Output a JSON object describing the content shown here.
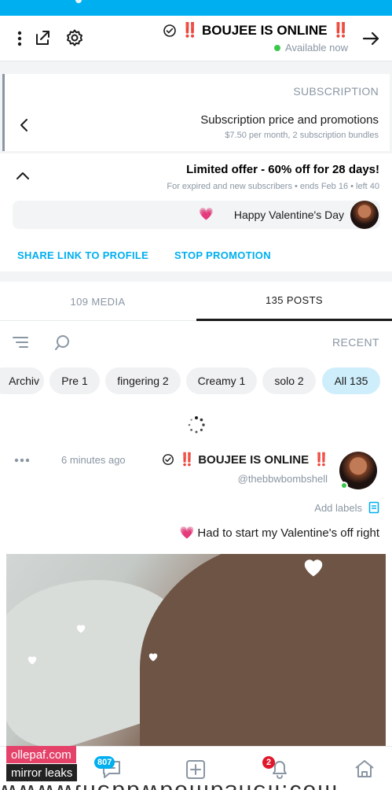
{
  "header": {
    "name": "BOUJEE IS ONLINE",
    "red_marks": "‼️",
    "status": "Available now"
  },
  "subscription": {
    "heading": "SUBSCRIPTION",
    "title": "Subscription price and promotions",
    "detail": "$7.50 per month, 2 subscription bundles"
  },
  "offer": {
    "title": "Limited offer - 60% off for 28 days!",
    "detail": "For expired and new subscribers • ends Feb 16 • left 40",
    "message": "Happy Valentine's Day",
    "message_emoji": "💗",
    "share_link": "SHARE LINK TO PROFILE",
    "stop_promotion": "STOP PROMOTION"
  },
  "tabs": [
    {
      "label": "135 POSTS"
    },
    {
      "label": "109 MEDIA"
    }
  ],
  "filter": {
    "sort_label": "RECENT"
  },
  "chips": [
    {
      "label": "All 135"
    },
    {
      "label": "solo 2"
    },
    {
      "label": "Creamy 1"
    },
    {
      "label": "fingering 2"
    },
    {
      "label": "Pre 1"
    },
    {
      "label": "Archiv"
    }
  ],
  "post": {
    "name": "BOUJEE IS ONLINE",
    "handle": "@thebbwbombshell",
    "time": "6 minutes ago",
    "add_labels": "Add labels",
    "text": "Had to start my Valentine's off right",
    "text_emoji": "💗"
  },
  "bottom_nav": {
    "messages_badge": "807",
    "notifications_badge": "2"
  },
  "watermark": {
    "line1": "ollepaf.com",
    "line2": "mirror leaks"
  },
  "colors": {
    "accent": "#00aff0",
    "badge_red": "#e0182d",
    "online_green": "#3cc74b",
    "muted": "#8a96a3"
  }
}
